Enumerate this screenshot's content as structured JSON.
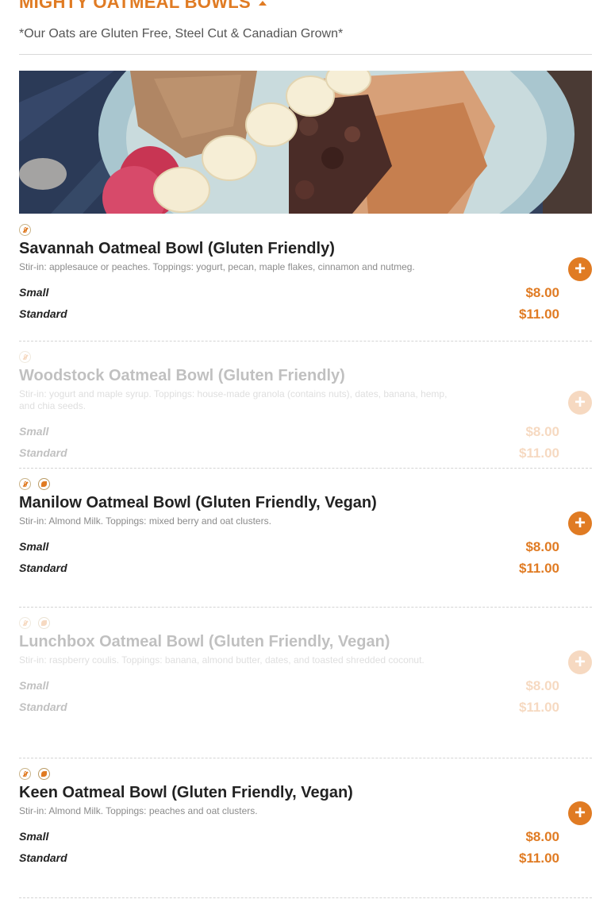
{
  "section": {
    "title": "MIGHTY OATMEAL BOWLS",
    "note": "*Our Oats are Gluten Free, Steel Cut & Canadian Grown*"
  },
  "colors": {
    "accent": "#e07b23",
    "text": "#222222",
    "muted": "#8b8b8b"
  },
  "icons": {
    "gluten_free": "gluten-free-icon",
    "vegan": "vegan-icon",
    "add": "plus-icon",
    "collapse": "caret-up-icon"
  },
  "items": [
    {
      "name": "Savannah Oatmeal Bowl (Gluten Friendly)",
      "description": "Stir-in: applesauce or peaches. Toppings: yogurt, pecan, maple flakes, cinnamon and nutmeg.",
      "sizes": [
        {
          "label": "Small",
          "price": "$8.00"
        },
        {
          "label": "Standard",
          "price": "$11.00"
        }
      ],
      "badges": [
        "gluten-free"
      ],
      "available": true
    },
    {
      "name": "Woodstock Oatmeal Bowl (Gluten Friendly)",
      "description": "Stir-in: yogurt and maple syrup. Toppings: house-made granola (contains nuts), dates, banana, hemp, and chia seeds.",
      "sizes": [
        {
          "label": "Small",
          "price": "$8.00"
        },
        {
          "label": "Standard",
          "price": "$11.00"
        }
      ],
      "badges": [
        "gluten-free"
      ],
      "available": false
    },
    {
      "name": "Manilow Oatmeal Bowl (Gluten Friendly, Vegan)",
      "description": "Stir-in: Almond Milk. Toppings: mixed berry and oat clusters.",
      "sizes": [
        {
          "label": "Small",
          "price": "$8.00"
        },
        {
          "label": "Standard",
          "price": "$11.00"
        }
      ],
      "badges": [
        "gluten-free",
        "vegan"
      ],
      "available": true
    },
    {
      "name": "Lunchbox Oatmeal Bowl (Gluten Friendly, Vegan)",
      "description": "Stir-in: raspberry coulis. Toppings: banana, almond butter, dates, and toasted shredded coconut.",
      "sizes": [
        {
          "label": "Small",
          "price": "$8.00"
        },
        {
          "label": "Standard",
          "price": "$11.00"
        }
      ],
      "badges": [
        "gluten-free",
        "vegan"
      ],
      "available": false
    },
    {
      "name": "Keen Oatmeal Bowl (Gluten Friendly, Vegan)",
      "description": "Stir-in: Almond Milk. Toppings: peaches and oat clusters.",
      "sizes": [
        {
          "label": "Small",
          "price": "$8.00"
        },
        {
          "label": "Standard",
          "price": "$11.00"
        }
      ],
      "badges": [
        "gluten-free",
        "vegan"
      ],
      "available": true
    }
  ]
}
